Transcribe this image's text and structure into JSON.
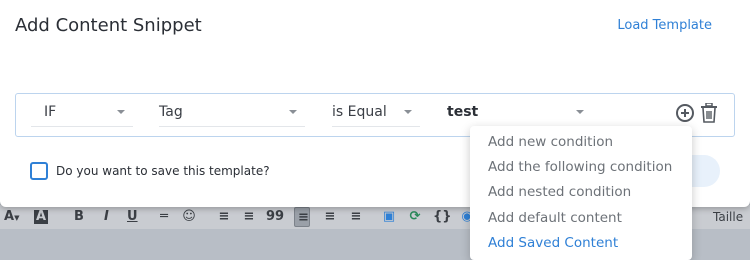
{
  "modal": {
    "title": "Add Content Snippet",
    "load_template": "Load Template",
    "save_prompt": "Do you want to save this template?"
  },
  "rule": {
    "condition": "IF",
    "field": "Tag",
    "operator": "is Equal",
    "value": "test"
  },
  "menu": {
    "items": [
      "Add new condition",
      "Add the following condition",
      "Add nested condition",
      "Add default content",
      "Add Saved Content"
    ]
  },
  "editor_toolbar": {
    "text_color": "A",
    "highlight": "A",
    "bold": "B",
    "italic": "I",
    "underline": "U",
    "quote": "99",
    "font_size_label": "Taille"
  },
  "colors": {
    "accent": "#2f80d6",
    "menu_text": "#6d7278",
    "border": "#bcd4ee"
  }
}
